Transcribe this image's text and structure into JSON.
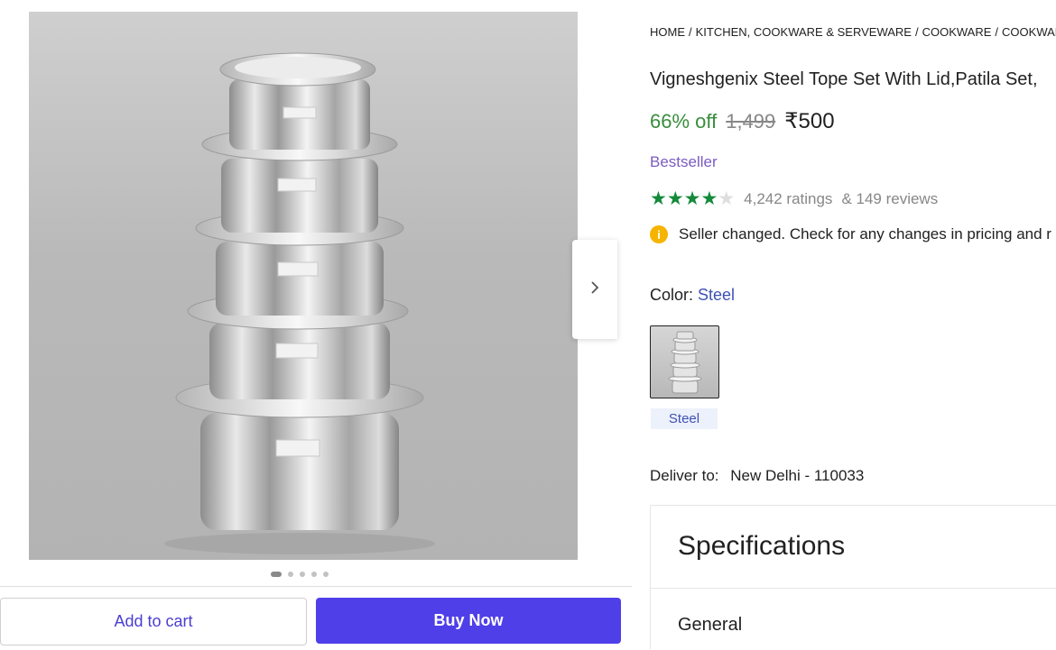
{
  "breadcrumb": [
    "HOME",
    "/",
    "KITCHEN, COOKWARE & SERVEWARE",
    "/",
    "COOKWARE",
    "/",
    "COOKWARE S"
  ],
  "product": {
    "title": "Vigneshgenix Steel Tope Set With Lid,Patila Set,",
    "discount": "66% off",
    "mrp": "1,499",
    "price": "₹500",
    "badge": "Bestseller",
    "rating_value": 4,
    "rating_max": 5,
    "ratings_count": "4,242 ratings",
    "reviews": "& 149 reviews"
  },
  "notice": {
    "icon": "info-icon",
    "text": "Seller changed. Check for any changes in pricing and r"
  },
  "color": {
    "label": "Color:",
    "value": "Steel",
    "swatch_label": "Steel"
  },
  "delivery": {
    "label": "Deliver to:",
    "location": "New Delhi - 110033"
  },
  "specs": {
    "title": "Specifications",
    "section": "General"
  },
  "gallery": {
    "image_count": 5,
    "active_index": 0,
    "next_icon": "chevron-right-icon"
  },
  "actions": {
    "add_to_cart": "Add to cart",
    "buy_now": "Buy Now"
  },
  "colors": {
    "green": "#388e3c",
    "purple_button": "#4f3fe8",
    "star": "#148a3a",
    "badge": "#7b5cc0",
    "link": "#3f51b5"
  }
}
